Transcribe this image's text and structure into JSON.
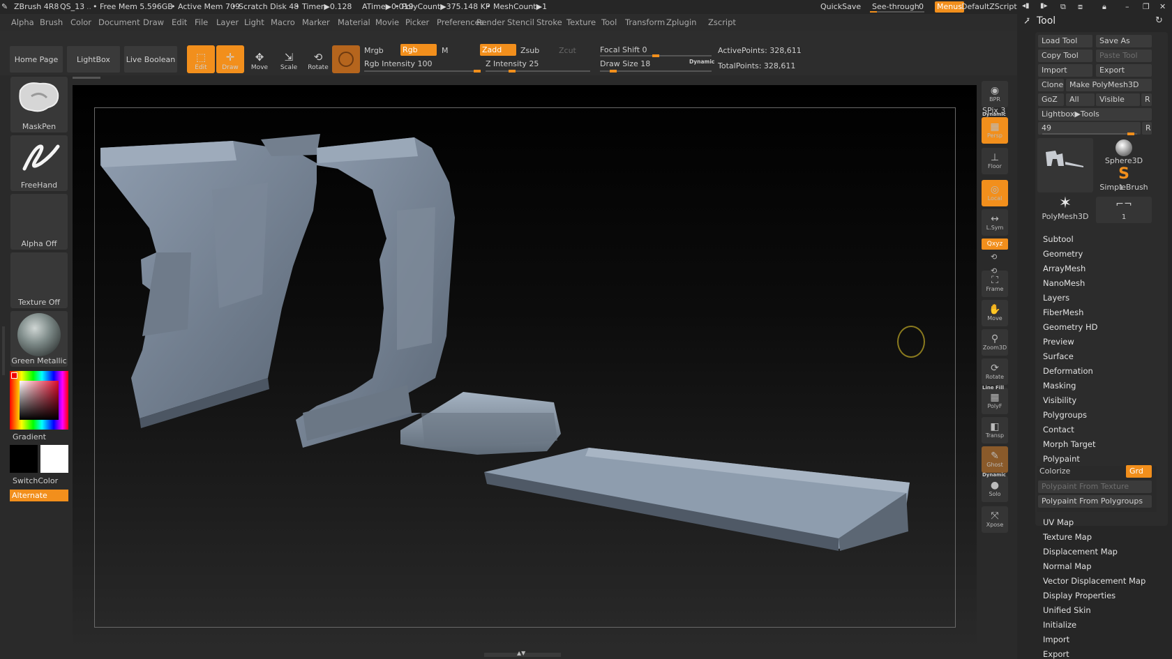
{
  "titlebar": {
    "app": "ZBrush 4R8",
    "file": "QS_13",
    "free_mem": "• Free Mem 5.596GB",
    "active_mem": "• Active Mem 709",
    "scratch": "• Scratch Disk 48",
    "timer": "• Timer▶0.128",
    "atime": "ATime▶0.019",
    "polycount": "• PolyCount▶375.148 KP",
    "meshcount": "• MeshCount▶1",
    "quicksave": "QuickSave",
    "see_through": "See-through",
    "see_through_value": "0",
    "menus": "Menus",
    "script": "DefaultZScript"
  },
  "menubar": [
    "Alpha",
    "Brush",
    "Color",
    "Document",
    "Draw",
    "Edit",
    "File",
    "Layer",
    "Light",
    "Macro",
    "Marker",
    "Material",
    "Movie",
    "Picker",
    "Preferences",
    "Render",
    "Stencil",
    "Stroke",
    "Texture",
    "Tool",
    "Transform",
    "Zplugin",
    "Zscript"
  ],
  "topshelf": {
    "home": "Home Page",
    "lightbox": "LightBox",
    "live_boolean": "Live Boolean",
    "tools": [
      {
        "label": "Edit",
        "icon": "edit-icon",
        "active": true
      },
      {
        "label": "Draw",
        "icon": "draw-icon",
        "active": true
      },
      {
        "label": "Move",
        "icon": "move-icon",
        "active": false
      },
      {
        "label": "Scale",
        "icon": "scale-icon",
        "active": false
      },
      {
        "label": "Rotate",
        "icon": "rotate-icon",
        "active": false
      }
    ],
    "mrgb": "Mrgb",
    "rgb": "Rgb",
    "m": "M",
    "zadd": "Zadd",
    "zsub": "Zsub",
    "zcut": "Zcut",
    "rgb_intensity": "Rgb Intensity 100",
    "z_intensity": "Z Intensity 25",
    "focal_shift": "Focal Shift 0",
    "draw_size": "Draw Size 18",
    "dynamic": "Dynamic",
    "active_points": "ActivePoints: 328,611",
    "total_points": "TotalPoints: 328,611",
    "rgb_intensity_level": 1.0,
    "z_intensity_level": 0.25,
    "focal_level": 0.5,
    "draw_size_level": 0.12
  },
  "leftshelf": {
    "brush": "MaskPen",
    "stroke": "FreeHand",
    "alpha": "Alpha Off",
    "texture": "Texture Off",
    "material": "Green Metallic",
    "gradient": "Gradient",
    "switch_color": "SwitchColor",
    "alternate": "Alternate",
    "main_color": "#000000",
    "secondary_color": "#ffffff"
  },
  "rightshelf": {
    "bpr": "BPR",
    "spix": "SPix 3",
    "persp": "Persp",
    "dynamic": "Dynamic",
    "floor": "Floor",
    "local": "Local",
    "lsym": "L.Sym",
    "xyz": "Qxyz",
    "frame": "Frame",
    "move": "Move",
    "zoom3d": "Zoom3D",
    "rotate": "Rotate",
    "line_fill": "Line Fill",
    "polyf": "PolyF",
    "transp": "Transp",
    "ghost": "Ghost",
    "solo": "Solo",
    "xpose": "Xpose"
  },
  "toolpanel": {
    "title": "Tool",
    "load_tool": "Load Tool",
    "save_as": "Save As",
    "copy_tool": "Copy Tool",
    "paste_tool": "Paste Tool",
    "import": "Import",
    "export": "Export",
    "clone": "Clone",
    "make_polymesh": "Make PolyMesh3D",
    "goz": "GoZ",
    "all": "All",
    "visible": "Visible",
    "r": "R",
    "lightbox_tools": "Lightbox▶Tools",
    "tool_count": "49",
    "slider_level": 0.97,
    "thumbs": [
      {
        "label": "1",
        "icon": "current-tool-thumb"
      },
      {
        "label": "Sphere3D",
        "icon": "sphere-icon"
      },
      {
        "label": "SimpleBrush",
        "icon": "simplebrush-icon"
      },
      {
        "label": "PolyMesh3D",
        "icon": "polymesh-star-icon"
      },
      {
        "label": "1",
        "icon": "tool-thumb-small"
      }
    ],
    "sections": [
      "Subtool",
      "Geometry",
      "ArrayMesh",
      "NanoMesh",
      "Layers",
      "FiberMesh",
      "Geometry HD",
      "Preview",
      "Surface",
      "Deformation",
      "Masking",
      "Visibility",
      "Polygroups",
      "Contact",
      "Morph Target",
      "Polypaint"
    ],
    "colorize": "Colorize",
    "grd": "Grd",
    "polypaint_from_texture": "Polypaint From Texture",
    "polypaint_from_polygroups": "Polypaint From Polygroups",
    "sections2": [
      "UV Map",
      "Texture Map",
      "Displacement Map",
      "Normal Map",
      "Vector Displacement Map",
      "Display Properties",
      "Unified Skin",
      "Initialize",
      "Import",
      "Export"
    ]
  },
  "colors": {
    "accent": "#f28f1c",
    "mesh": "#7d8b9b"
  }
}
